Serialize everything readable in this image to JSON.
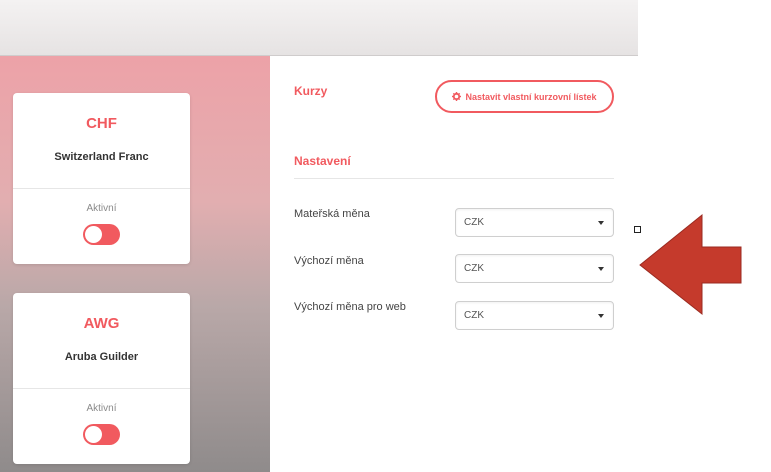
{
  "sidebar": {
    "cards": [
      {
        "code": "CHF",
        "name": "Switzerland Franc",
        "status": "Aktivní",
        "active": true
      },
      {
        "code": "AWG",
        "name": "Aruba Guilder",
        "status": "Aktivní",
        "active": true
      }
    ]
  },
  "main": {
    "rates_title": "Kurzy",
    "custom_rates_button": "Nastavit vlastní kurzovní lístek",
    "settings_title": "Nastavení",
    "rows": [
      {
        "label": "Mateřská měna",
        "value": "CZK"
      },
      {
        "label": "Výchozí měna",
        "value": "CZK"
      },
      {
        "label": "Výchozí měna pro web",
        "value": "CZK"
      }
    ]
  },
  "icons": {
    "gear": "gear-icon",
    "caret": "chevron-down-icon",
    "arrow": "left-arrow-annotation"
  },
  "colors": {
    "accent": "#f15a5f",
    "arrow": "#c53a2c"
  }
}
